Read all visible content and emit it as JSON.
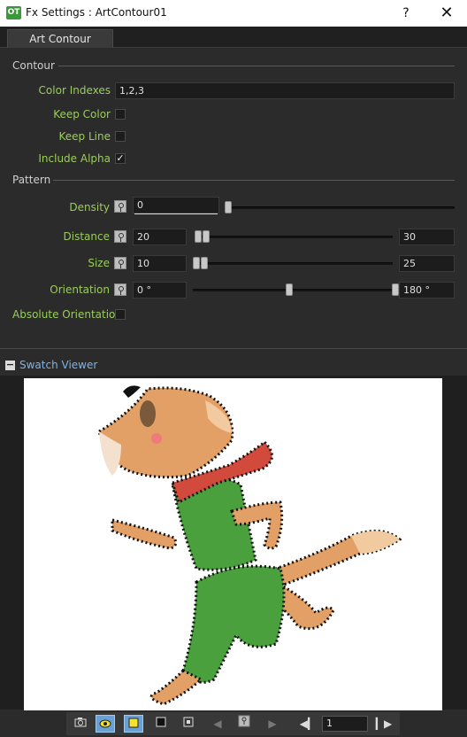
{
  "window": {
    "app_icon_text": "OT",
    "title": "Fx Settings : ArtContour01",
    "help_label": "?",
    "close_label": "✕"
  },
  "tabs": [
    {
      "label": "Art Contour"
    }
  ],
  "contour": {
    "heading": "Contour",
    "color_indexes": {
      "label": "Color Indexes",
      "value": "1,2,3"
    },
    "keep_color": {
      "label": "Keep Color",
      "checked": false
    },
    "keep_line": {
      "label": "Keep Line",
      "checked": false
    },
    "include_alpha": {
      "label": "Include Alpha",
      "checked": true,
      "mark": "✓"
    }
  },
  "pattern": {
    "heading": "Pattern",
    "density": {
      "label": "Density",
      "value": "0",
      "slider": 0.0
    },
    "distance": {
      "label": "Distance",
      "min_value": "20",
      "max_value": "30"
    },
    "size": {
      "label": "Size",
      "min_value": "10",
      "max_value": "25"
    },
    "orientation": {
      "label": "Orientation",
      "min_value": "0 °",
      "max_value": "180 °"
    },
    "absolute_orientation": {
      "label": "Absolute Orientation",
      "checked": false
    }
  },
  "swatch": {
    "title": "Swatch Viewer",
    "collapse_label": "−"
  },
  "toolbar": {
    "frame": "1"
  },
  "colors": {
    "accent_label": "#9acd5a",
    "link": "#7fb3e6",
    "toggle_active": "#6aa0d4"
  }
}
